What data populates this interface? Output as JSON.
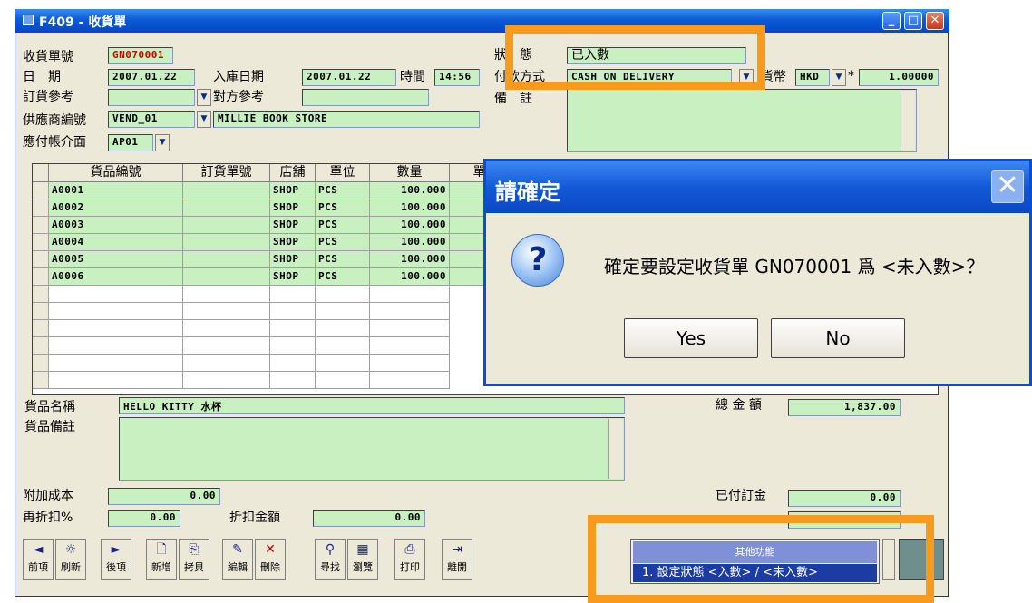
{
  "window": {
    "title": "F409 - 收貨單"
  },
  "header": {
    "receipt_no_label": "收貨單號",
    "receipt_no": "GN070001",
    "date_label": "日　期",
    "date": "2007.01.22",
    "stock_in_date_label": "入庫日期",
    "stock_in_date": "2007.01.22",
    "time_label": "時間",
    "time": "14:56",
    "order_ref_label": "訂貨參考",
    "order_ref": "",
    "counter_ref_label": "對方參考",
    "counter_ref": "",
    "supplier_label": "供應商編號",
    "supplier_code": "VEND_01",
    "supplier_name": "MILLIE BOOK STORE",
    "ap_label": "應付帳介面",
    "ap_code": "AP01",
    "status_label": "狀　態",
    "status": "已入數",
    "payment_label": "付款方式",
    "payment": "CASH ON DELIVERY",
    "currency_label": "貨幣",
    "currency": "HKD",
    "rate_sign": "*",
    "rate": "1.00000",
    "remarks_label": "備　註",
    "remarks": ""
  },
  "grid": {
    "columns": [
      "貨品編號",
      "訂貨單號",
      "店舖",
      "單位",
      "數量",
      "單價"
    ],
    "rows": [
      [
        "A0001",
        "",
        "SHOP",
        "PCS",
        "100.000"
      ],
      [
        "A0002",
        "",
        "SHOP",
        "PCS",
        "100.000"
      ],
      [
        "A0003",
        "",
        "SHOP",
        "PCS",
        "100.000"
      ],
      [
        "A0004",
        "",
        "SHOP",
        "PCS",
        "100.000"
      ],
      [
        "A0005",
        "",
        "SHOP",
        "PCS",
        "100.000"
      ],
      [
        "A0006",
        "",
        "SHOP",
        "PCS",
        "100.000"
      ]
    ]
  },
  "item": {
    "name_label": "貨品名稱",
    "name": "HELLO KITTY 水杯",
    "remark_label": "貨品備註",
    "remark": "",
    "total_label": "總 金 額",
    "total": "1,837.00"
  },
  "footer": {
    "extra_cost_label": "附加成本",
    "extra_cost": "0.00",
    "rediscount_label": "再折扣%",
    "rediscount": "0.00",
    "discount_amount_label": "折扣金額",
    "discount_amount": "0.00",
    "deposit_label": "已付訂金",
    "deposit": "0.00"
  },
  "toolbar": [
    {
      "icon": "arrow-left",
      "glyph": "◄",
      "label": "前項"
    },
    {
      "icon": "refresh",
      "glyph": "☼",
      "label": "刷新"
    },
    {
      "icon": "arrow-right",
      "glyph": "►",
      "label": "後項"
    },
    {
      "icon": "new",
      "glyph": "🗋",
      "label": "新增"
    },
    {
      "icon": "copy",
      "glyph": "⎘",
      "label": "拷貝"
    },
    {
      "icon": "edit",
      "glyph": "✎",
      "label": "編輯"
    },
    {
      "icon": "delete",
      "glyph": "✕",
      "label": "刪除"
    },
    {
      "icon": "find",
      "glyph": "⚲",
      "label": "尋找"
    },
    {
      "icon": "browse",
      "glyph": "▦",
      "label": "瀏覽"
    },
    {
      "icon": "print",
      "glyph": "⎙",
      "label": "打印"
    },
    {
      "icon": "exit",
      "glyph": "⇥",
      "label": "離開"
    }
  ],
  "dialog": {
    "title": "請確定",
    "message": "確定要設定收貨單 GN070001  爲 <未入數>？",
    "yes": "Yes",
    "no": "No"
  },
  "menu": {
    "header": "其他功能",
    "item": "1. 設定狀態 <入數> / <未入數>"
  },
  "colors": {
    "highlight": "#f79a1e",
    "field": "#c8f0c0",
    "title": "#0a5bd6"
  }
}
